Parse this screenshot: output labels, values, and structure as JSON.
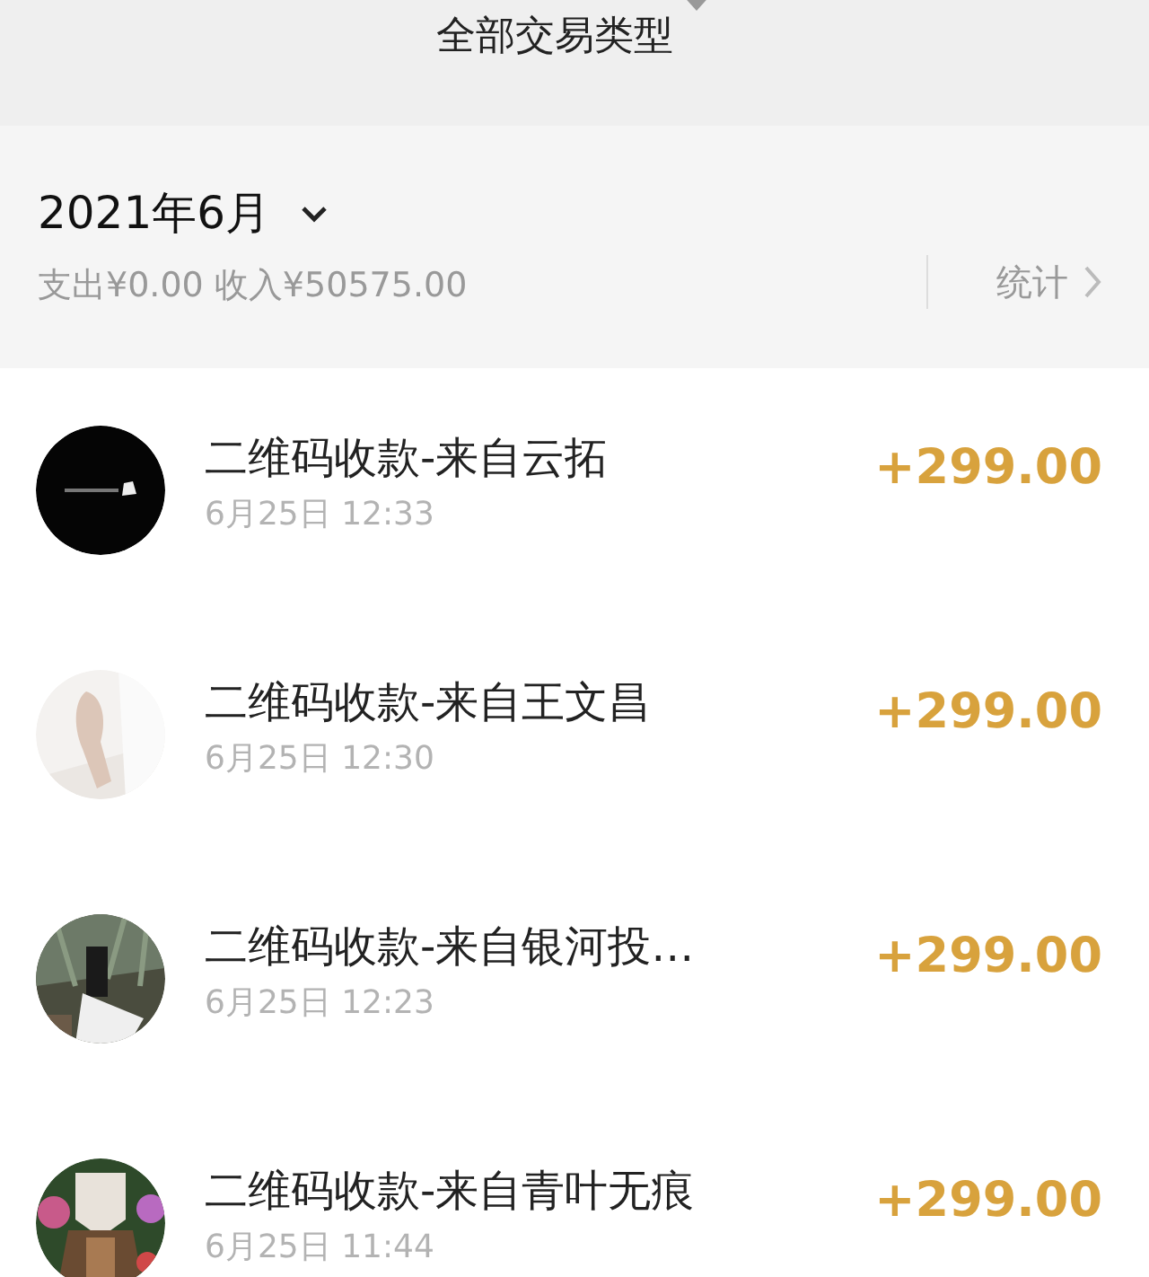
{
  "header": {
    "title": "全部交易类型"
  },
  "month": {
    "label": "2021年6月",
    "summary": "支出¥0.00 收入¥50575.00",
    "stats_link": "统计"
  },
  "transactions": [
    {
      "title": "二维码收款-来自云拓",
      "time": "6月25日 12:33",
      "amount": "+299.00"
    },
    {
      "title": "二维码收款-来自王文昌",
      "time": "6月25日 12:30",
      "amount": "+299.00"
    },
    {
      "title": "二维码收款-来自银河投…",
      "time": "6月25日 12:23",
      "amount": "+299.00"
    },
    {
      "title": "二维码收款-来自青叶无痕",
      "time": "6月25日 11:44",
      "amount": "+299.00"
    }
  ]
}
